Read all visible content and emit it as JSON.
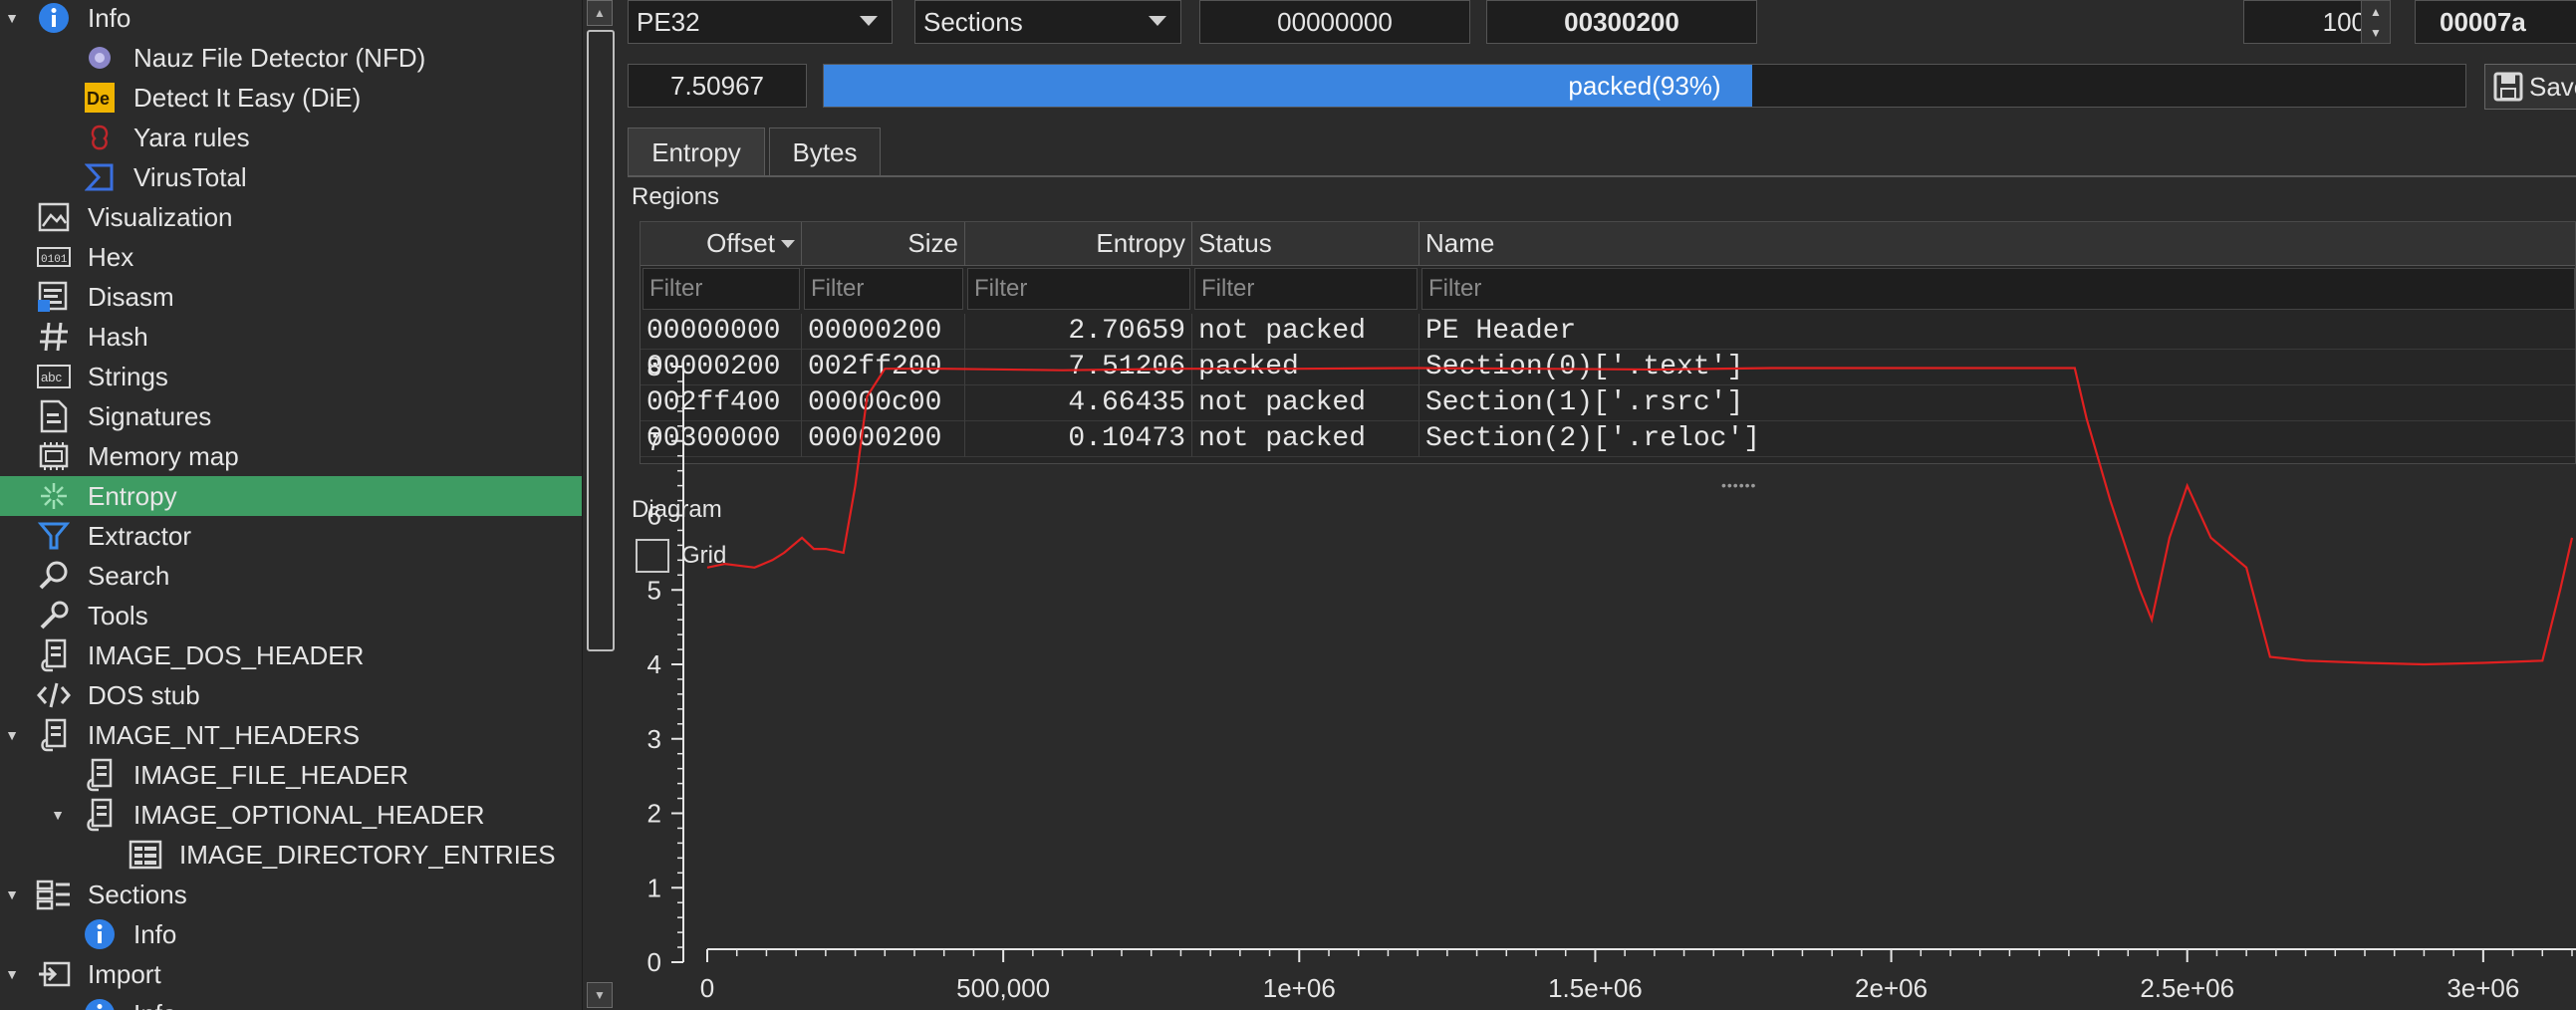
{
  "tree": {
    "items": [
      {
        "label": "Info",
        "icon": "info-icon",
        "expander": "open"
      },
      {
        "label": "Nauz File Detector (NFD)",
        "icon": "nfd-icon"
      },
      {
        "label": "Detect It Easy (DiE)",
        "icon": "die-icon"
      },
      {
        "label": "Yara rules",
        "icon": "yara-icon"
      },
      {
        "label": "VirusTotal",
        "icon": "virustotal-icon"
      },
      {
        "label": "Visualization",
        "icon": "visualization-icon"
      },
      {
        "label": "Hex",
        "icon": "hex-icon"
      },
      {
        "label": "Disasm",
        "icon": "disasm-icon"
      },
      {
        "label": "Hash",
        "icon": "hash-icon"
      },
      {
        "label": "Strings",
        "icon": "strings-icon"
      },
      {
        "label": "Signatures",
        "icon": "signatures-icon"
      },
      {
        "label": "Memory map",
        "icon": "memory-map-icon"
      },
      {
        "label": "Entropy",
        "icon": "entropy-icon",
        "selected": true
      },
      {
        "label": "Extractor",
        "icon": "extractor-icon"
      },
      {
        "label": "Search",
        "icon": "search-icon"
      },
      {
        "label": "Tools",
        "icon": "tools-icon"
      },
      {
        "label": "IMAGE_DOS_HEADER",
        "icon": "struct-icon"
      },
      {
        "label": "DOS stub",
        "icon": "code-icon"
      },
      {
        "label": "IMAGE_NT_HEADERS",
        "icon": "struct-icon",
        "expander": "open"
      },
      {
        "label": "IMAGE_FILE_HEADER",
        "icon": "struct-icon"
      },
      {
        "label": "IMAGE_OPTIONAL_HEADER",
        "icon": "struct-icon",
        "expander": "open"
      },
      {
        "label": "IMAGE_DIRECTORY_ENTRIES",
        "icon": "table-icon"
      },
      {
        "label": "Sections",
        "icon": "sections-icon",
        "expander": "open"
      },
      {
        "label": "Info",
        "icon": "info-icon"
      },
      {
        "label": "Import",
        "icon": "import-icon",
        "expander": "open"
      },
      {
        "label": "Info",
        "icon": "info-icon"
      }
    ]
  },
  "toolbar": {
    "type_select": "PE32",
    "mode_select": "Sections",
    "offset_value": "00000000",
    "size_value": "00300200",
    "count_value": "100",
    "right_value": "00007a",
    "entropy_value": "7.50967",
    "progress_label": "packed(93%)",
    "progress_percent": 93,
    "save_label": "Save"
  },
  "tabs": [
    "Entropy",
    "Bytes"
  ],
  "active_tab": "Entropy",
  "regions": {
    "title": "Regions",
    "columns": [
      "Offset",
      "Size",
      "Entropy",
      "Status",
      "Name"
    ],
    "filter_placeholder": "Filter",
    "rows": [
      [
        "00000000",
        "00000200",
        "2.70659",
        "not packed",
        "PE Header"
      ],
      [
        "00000200",
        "002ff200",
        "7.51206",
        "packed",
        "Section(0)['.text']"
      ],
      [
        "002ff400",
        "00000c00",
        "4.66435",
        "not packed",
        "Section(1)['.rsrc']"
      ],
      [
        "00300000",
        "00000200",
        "0.10473",
        "not packed",
        "Section(2)['.reloc']"
      ]
    ]
  },
  "diagram": {
    "title": "Diagram",
    "grid_label": "Grid",
    "grid_checked": false
  },
  "chart_data": {
    "type": "line",
    "line_color": "#e02020",
    "ylim": [
      0,
      8
    ],
    "yticks": [
      "0",
      "1",
      "2",
      "3",
      "4",
      "5",
      "6",
      "7",
      "8"
    ],
    "xticks": [
      "0",
      "500,000",
      "1e+06",
      "1.5e+06",
      "2e+06",
      "2.5e+06",
      "3e+06"
    ],
    "xtick_values": [
      0,
      500000,
      1000000,
      1500000,
      2000000,
      2500000,
      3000000
    ],
    "xlim": [
      0,
      3150000
    ],
    "grid": false,
    "series": [
      {
        "x": [
          0,
          30000,
          80000,
          110000,
          130000,
          160000,
          180000,
          200000,
          230000,
          250000,
          270000,
          300000,
          400000,
          600000,
          800000,
          1000000,
          1200000,
          1400000,
          1600000,
          1800000,
          2000000,
          2200000,
          2310000,
          2330000,
          2370000,
          2420000,
          2440000,
          2470000,
          2500000,
          2540000,
          2600000,
          2640000,
          2700000,
          2800000,
          2900000,
          3000000,
          3100000,
          3130000,
          3150000
        ],
        "y": [
          5.3,
          5.35,
          5.3,
          5.4,
          5.5,
          5.7,
          5.55,
          5.55,
          5.5,
          6.4,
          7.6,
          7.97,
          7.97,
          7.95,
          7.97,
          7.97,
          7.98,
          7.97,
          7.96,
          7.98,
          7.98,
          7.98,
          7.98,
          7.3,
          6.2,
          5.0,
          4.6,
          5.7,
          6.4,
          5.7,
          5.3,
          4.1,
          4.05,
          4.02,
          4.0,
          4.02,
          4.05,
          5.0,
          5.7
        ]
      }
    ]
  }
}
